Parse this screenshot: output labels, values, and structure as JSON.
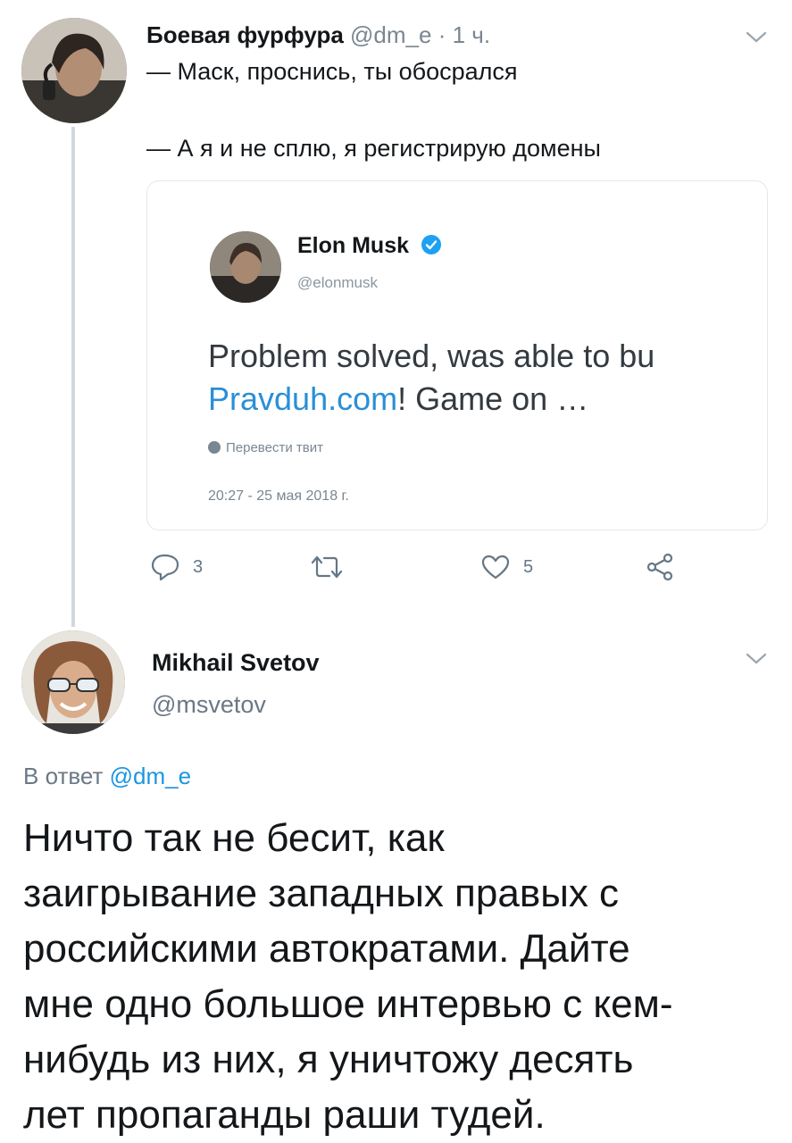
{
  "tweet1": {
    "author_name": "Боевая фурфура",
    "handle": "@dm_e",
    "separator": "·",
    "time": "1 ч.",
    "lines": [
      "— Маск, проснись, ты обосрался",
      "— А я и не сплю, я регистрирую домены"
    ],
    "quoted": {
      "author_name": "Elon Musk",
      "handle": "@elonmusk",
      "text_start": "Problem solved, was able to bu",
      "link": "Pravduh.com",
      "text_end": "! Game on …",
      "translate_label": "Перевести твит",
      "date": "20:27 - 25 мая 2018 г."
    },
    "actions": {
      "reply_count": "3",
      "retweet_count": "",
      "like_count": "5"
    }
  },
  "tweet2": {
    "author_name": "Mikhail Svetov",
    "handle": "@msvetov",
    "reply_label": "В ответ",
    "reply_mention": "@dm_e",
    "body_lines": [
      "Ничто так не бесит, как",
      "заигрывание западных правых с",
      "российскими автократами. Дайте",
      "мне одно большое интервью с кем-",
      "нибудь из них, я уничтожу десять",
      "лет пропаганды раши тудей."
    ]
  },
  "icons": {
    "caret": "chevron-down-icon",
    "verified": "verified-badge-icon",
    "reply": "reply-icon",
    "retweet": "retweet-icon",
    "like": "heart-icon",
    "share": "share-icon",
    "translate": "globe-icon"
  },
  "colors": {
    "link": "#1b95e0",
    "muted": "#657786",
    "verified": "#1da1f2",
    "thread_line": "#cfd9de"
  }
}
